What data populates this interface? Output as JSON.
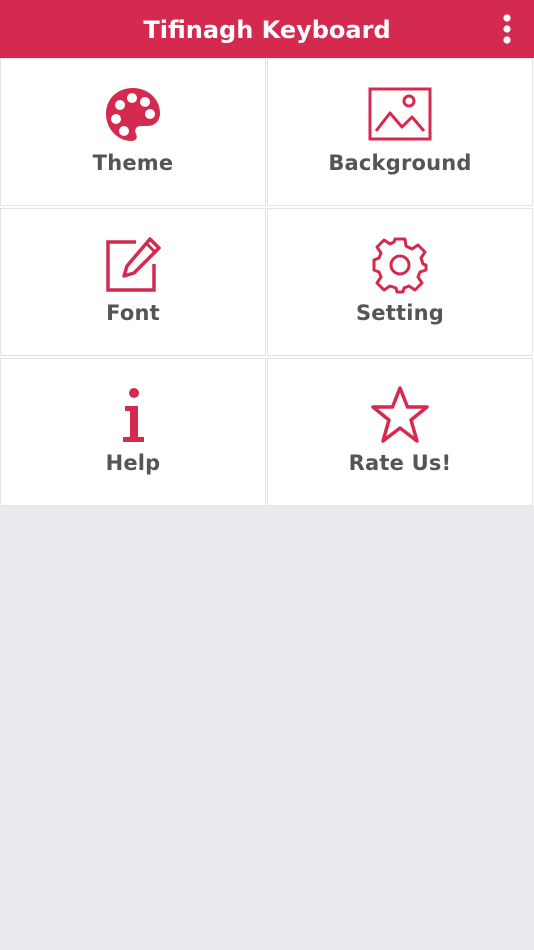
{
  "app_bar": {
    "title": "Tifinagh Keyboard",
    "overflow_icon": "vertical-dots-icon"
  },
  "menu": {
    "items": [
      {
        "label": "Theme",
        "icon": "palette-icon"
      },
      {
        "label": "Background",
        "icon": "image-icon"
      },
      {
        "label": "Font",
        "icon": "edit-icon"
      },
      {
        "label": "Setting",
        "icon": "gear-icon"
      },
      {
        "label": "Help",
        "icon": "info-icon"
      },
      {
        "label": "Rate Us!",
        "icon": "star-icon"
      }
    ]
  },
  "colors": {
    "accent": "#d42a50",
    "label_text": "#555555",
    "background": "#ebeaf0",
    "tile": "#ffffff"
  }
}
